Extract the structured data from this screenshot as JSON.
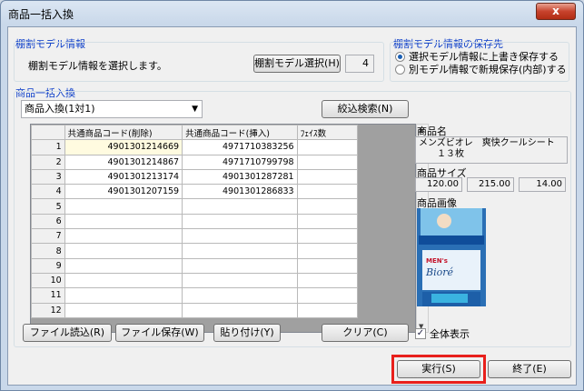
{
  "window": {
    "title": "商品一括入換",
    "close_label": "x"
  },
  "model_info": {
    "title": "棚割モデル情報",
    "description": "棚割モデル情報を選択します。",
    "select_button": "棚割モデル選択(H)",
    "count": "4"
  },
  "save_options": {
    "title": "棚割モデル情報の保存先",
    "options": [
      {
        "label": "選択モデル情報に上書き保存する",
        "selected": true
      },
      {
        "label": "別モデル情報で新規保存(内部)する",
        "selected": false
      }
    ]
  },
  "bulk": {
    "title": "商品一括入換",
    "dropdown_value": "商品入換(1対1)",
    "search_button": "絞込検索(N)"
  },
  "grid": {
    "headers": [
      "共通商品コード(削除)",
      "共通商品コード(挿入)",
      "ﾌｪｲｽ数"
    ],
    "row_numbers": [
      "1",
      "2",
      "3",
      "4",
      "5",
      "6",
      "7",
      "8",
      "9",
      "10",
      "11",
      "12"
    ],
    "rows": [
      [
        "4901301214669",
        "4971710383256",
        ""
      ],
      [
        "4901301214867",
        "4971710799798",
        ""
      ],
      [
        "4901301213174",
        "4901301287281",
        ""
      ],
      [
        "4901301207159",
        "4901301286833",
        ""
      ],
      [
        "",
        "",
        ""
      ],
      [
        "",
        "",
        ""
      ],
      [
        "",
        "",
        ""
      ],
      [
        "",
        "",
        ""
      ],
      [
        "",
        "",
        ""
      ],
      [
        "",
        "",
        ""
      ],
      [
        "",
        "",
        ""
      ],
      [
        "",
        "",
        ""
      ]
    ]
  },
  "product": {
    "name_label": "商品名",
    "name_line1": "メンズビオレ　爽快クールシート",
    "name_line2": "１３枚",
    "size_label": "商品サイズ",
    "sizes": [
      "120.00",
      "215.00",
      "14.00"
    ],
    "image_label": "商品画像",
    "image_text_brand": "MEN's",
    "image_text_logo": "Bioré"
  },
  "buttons": {
    "file_load": "ファイル読込(R)",
    "file_save": "ファイル保存(W)",
    "paste": "貼り付け(Y)",
    "clear": "クリア(C)",
    "show_all": "全体表示",
    "execute": "実行(S)",
    "exit": "終了(E)"
  },
  "show_all_checked": true,
  "colors": {
    "group_title": "#0a3cc8",
    "highlight": "#e8201c"
  }
}
